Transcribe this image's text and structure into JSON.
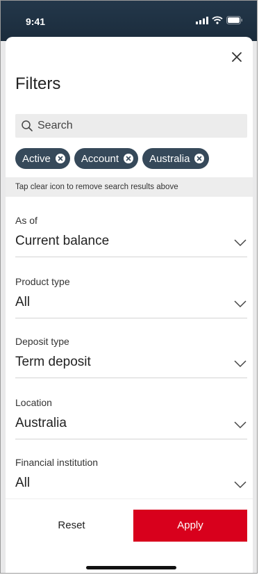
{
  "status": {
    "time": "9:41"
  },
  "sheet": {
    "title": "Filters",
    "search_placeholder": "Search",
    "chips": [
      "Active",
      "Account",
      "Australia"
    ],
    "hint": "Tap clear icon to remove search results above",
    "fields": [
      {
        "label": "As of",
        "value": "Current balance"
      },
      {
        "label": "Product type",
        "value": "All"
      },
      {
        "label": "Deposit type",
        "value": "Term deposit"
      },
      {
        "label": "Location",
        "value": "Australia"
      },
      {
        "label": "Financial institution",
        "value": "All"
      }
    ],
    "reset_label": "Reset",
    "apply_label": "Apply"
  },
  "colors": {
    "header_bg": "#1f3142",
    "chip_bg": "#36495a",
    "apply_bg": "#d8001c"
  }
}
